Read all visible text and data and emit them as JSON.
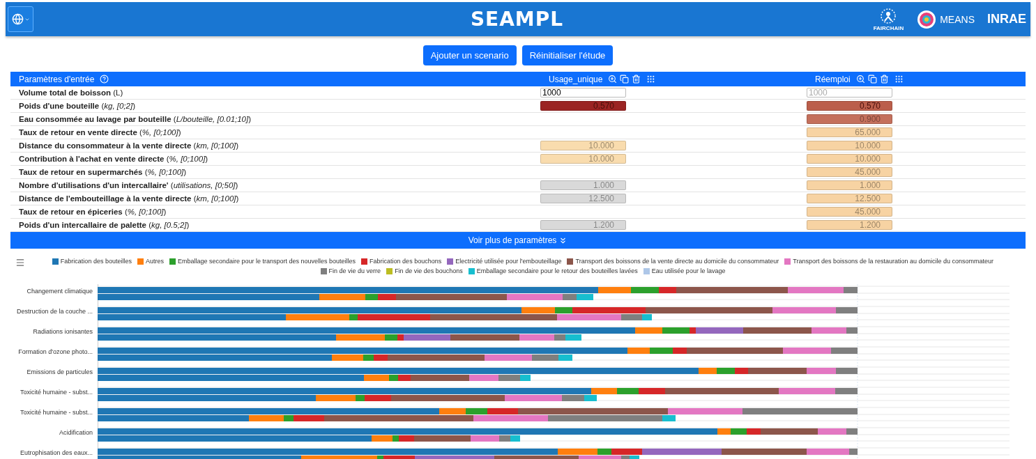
{
  "header": {
    "title": "SEAMPL",
    "logos": [
      "FAIRCHAIN",
      "MEANS",
      "INRAE"
    ]
  },
  "actions": [
    "Ajouter un scenario",
    "Réinitialiser l'étude"
  ],
  "table": {
    "title": "Paramètres d'entrée",
    "scenarios": [
      "Usage_unique",
      "Réemploi"
    ],
    "rows": [
      {
        "label": "Volume total de boisson",
        "unit": "(L)",
        "cells": [
          {
            "kind": "input",
            "value": "1000",
            "disabled": false
          },
          {
            "kind": "input",
            "value": "1000",
            "disabled": true
          }
        ]
      },
      {
        "label": "Poids d'une bouteille",
        "unit": "(*kg, [0;2]*)",
        "cells": [
          {
            "kind": "field",
            "value": "0.570",
            "color": "#9b2423"
          },
          {
            "kind": "field",
            "value": "0.570",
            "color": "#bb5e4b"
          }
        ]
      },
      {
        "label": "Eau consommée au lavage par bouteille",
        "unit": "(*L/bouteille, [0.01;10]*)",
        "cells": [
          {
            "kind": "empty"
          },
          {
            "kind": "field",
            "value": "0.900",
            "color": "#c4705c"
          }
        ]
      },
      {
        "label": "Taux de retour en vente directe",
        "unit": "(*%, [0;100]*)",
        "cells": [
          {
            "kind": "empty"
          },
          {
            "kind": "field",
            "value": "65.000",
            "color": "#f7d3a3"
          }
        ]
      },
      {
        "label": "Distance du consommateur à la vente directe",
        "unit": "(*km, [0;100]*)",
        "cells": [
          {
            "kind": "field",
            "value": "10.000",
            "color": "#f9dcae"
          },
          {
            "kind": "field",
            "value": "10.000",
            "color": "#f7d3a3"
          }
        ]
      },
      {
        "label": "Contribution à l'achat en vente directe",
        "unit": "(*%, [0;100]*)",
        "cells": [
          {
            "kind": "field",
            "value": "10.000",
            "color": "#f9dcae"
          },
          {
            "kind": "field",
            "value": "10.000",
            "color": "#f7d3a3"
          }
        ]
      },
      {
        "label": "Taux de retour en supermarchés",
        "unit": "(*%, [0;100]*)",
        "cells": [
          {
            "kind": "empty"
          },
          {
            "kind": "field",
            "value": "45.000",
            "color": "#f7d3a3"
          }
        ]
      },
      {
        "label": "Nombre d'utilisations d'un intercallaire'",
        "unit": "(*utilisations, [0;50]*)",
        "cells": [
          {
            "kind": "field",
            "value": "1.000",
            "color": "#d9d9d9"
          },
          {
            "kind": "field",
            "value": "1.000",
            "color": "#f7d3a3"
          }
        ]
      },
      {
        "label": "Distance de l'embouteillage à la vente directe",
        "unit": "(*km, [0;100]*)",
        "cells": [
          {
            "kind": "field",
            "value": "12.500",
            "color": "#d9d9d9"
          },
          {
            "kind": "field",
            "value": "12.500",
            "color": "#f7d3a3"
          }
        ]
      },
      {
        "label": "Taux de retour en épiceries",
        "unit": "(*%, [0;100]*)",
        "cells": [
          {
            "kind": "empty"
          },
          {
            "kind": "field",
            "value": "45.000",
            "color": "#f7d3a3"
          }
        ]
      },
      {
        "label": "Poids d'un intercallaire de palette",
        "unit": "(*kg, [0.5;2]*)",
        "cells": [
          {
            "kind": "field",
            "value": "1.200",
            "color": "#d9d9d9"
          },
          {
            "kind": "field",
            "value": "1.200",
            "color": "#f7d3a3"
          }
        ]
      }
    ],
    "more": "Voir plus de paramètres"
  },
  "legend": [
    {
      "label": "Fabrication des bouteilles",
      "color": "#1f77b4"
    },
    {
      "label": "Autres",
      "color": "#ff7f0e"
    },
    {
      "label": "Emballage secondaire pour le transport des nouvelles bouteilles",
      "color": "#2ca02c"
    },
    {
      "label": "Fabrication des bouchons",
      "color": "#d62728"
    },
    {
      "label": "Electricité utilisée pour l'embouteillage",
      "color": "#9467bd"
    },
    {
      "label": "Transport des boissons de la vente directe au domicile du consommateur",
      "color": "#8c564b"
    },
    {
      "label": "Transport des boissons de la restauration au domicile du consommateur",
      "color": "#e377c2"
    },
    {
      "label": "Fin de vie du verre",
      "color": "#7f7f7f"
    },
    {
      "label": "Fin de vie des bouchons",
      "color": "#bcbd22"
    },
    {
      "label": "Emballage secondaire pour le retour des bouteilles lavées",
      "color": "#17becf"
    },
    {
      "label": "Eau utilisée pour le lavage",
      "color": "#aec7e8"
    }
  ],
  "chart": {
    "categories": [
      "Changement climatique",
      "Destruction de la couche ...",
      "Radiations ionisantes",
      "Formation d'ozone photo...",
      "Emissions de particules",
      "Toxicité humaine - subst...",
      "Toxicité humaine - subst...",
      "Acidification",
      "Eutrophisation des eaux..."
    ]
  }
}
